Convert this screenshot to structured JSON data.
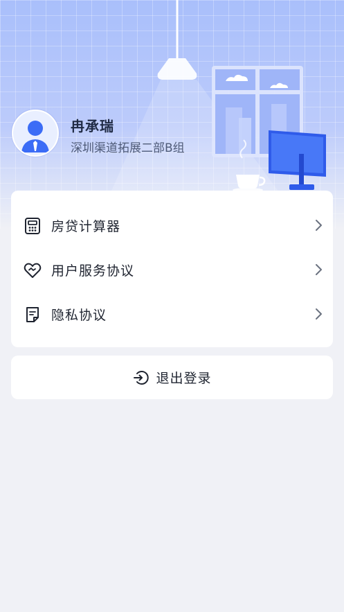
{
  "profile": {
    "name": "冉承瑞",
    "department": "深圳渠道拓展二部B组",
    "avatar_icon": "user-avatar-icon"
  },
  "menu": {
    "items": [
      {
        "label": "房贷计算器",
        "icon": "calculator-icon"
      },
      {
        "label": "用户服务协议",
        "icon": "heart-handshake-icon"
      },
      {
        "label": "隐私协议",
        "icon": "document-icon"
      }
    ],
    "chevron_icon": "chevron-right-icon"
  },
  "logout": {
    "label": "退出登录",
    "icon": "logout-icon"
  },
  "colors": {
    "accent": "#3b6cf6",
    "header_top": "#a9bffb",
    "background": "#f0f1f6",
    "text_primary": "#1f2430",
    "text_secondary": "#4f5b78"
  }
}
